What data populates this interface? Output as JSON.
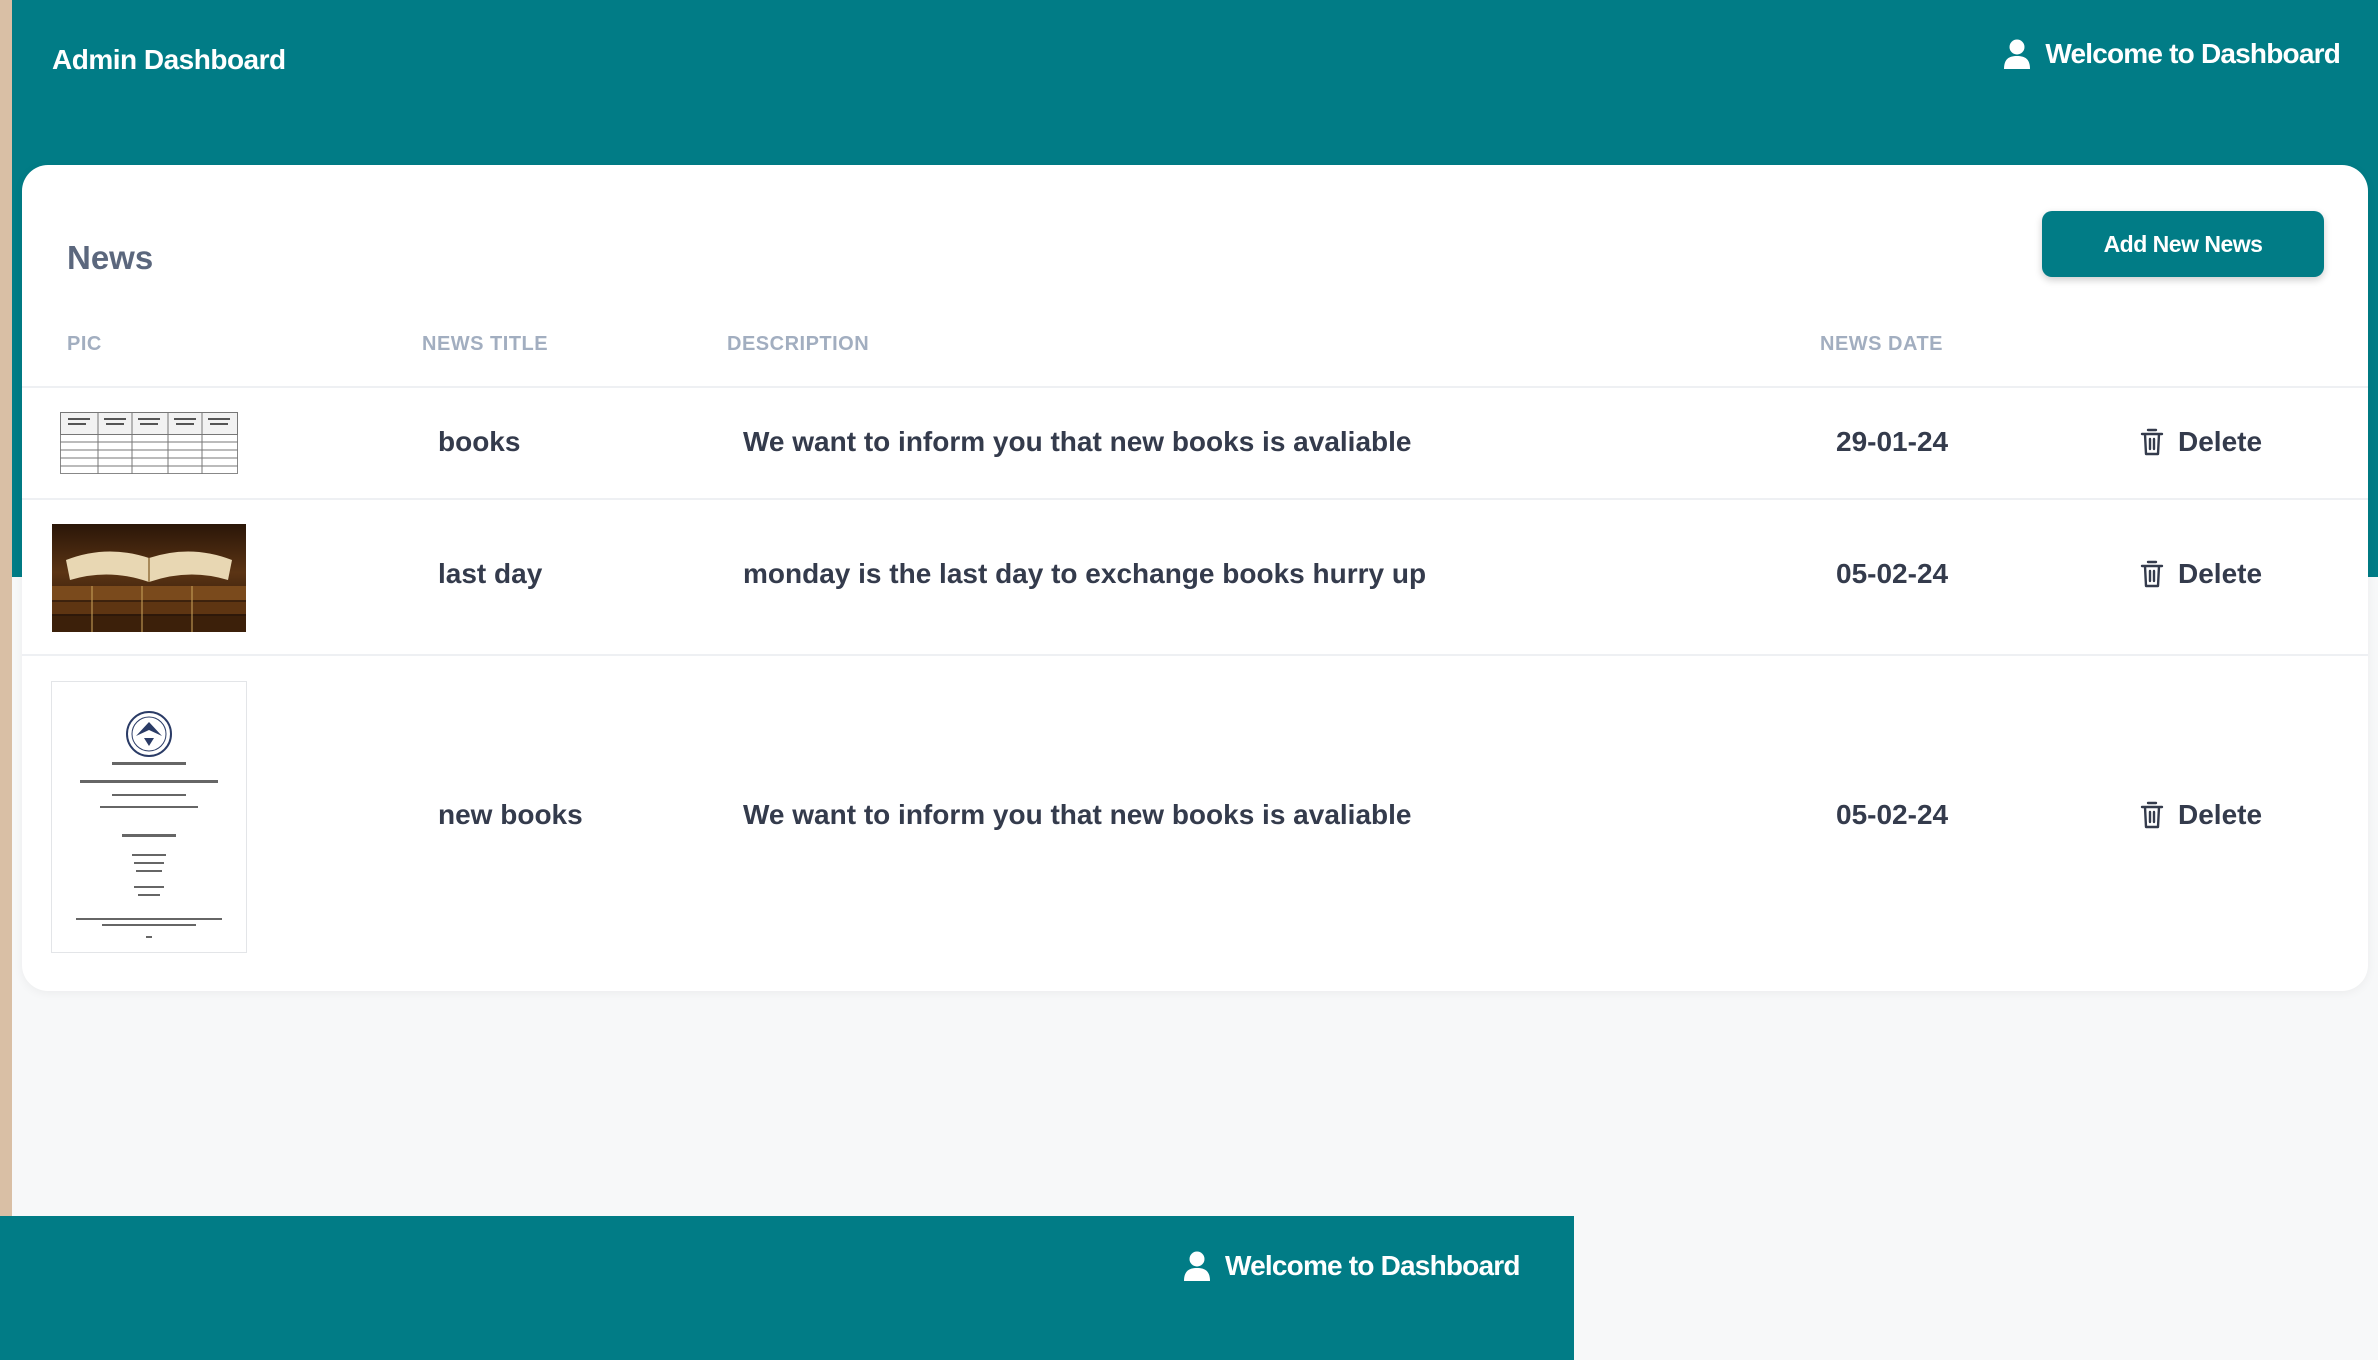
{
  "header": {
    "app_title": "Admin Dashboard",
    "welcome": "Welcome to Dashboard"
  },
  "footer": {
    "welcome": "Welcome to Dashboard"
  },
  "colors": {
    "primary": "#017c86",
    "page_bg": "#f7f8f9",
    "left_strip": "#d9bfa5",
    "text": "#343b4c",
    "muted": "#a2aec0"
  },
  "news": {
    "title": "News",
    "add_button": "Add New News",
    "columns": [
      "PIC",
      "NEWS TITLE",
      "DESCRIPTION",
      "NEWS DATE"
    ],
    "rows": [
      {
        "title": "books",
        "description": "We want to inform you that new books is avaliable",
        "date": "29-01-24",
        "action": "Delete",
        "pic": "table-document-thumbnail"
      },
      {
        "title": "last day",
        "description": "monday is the last day to exchange books hurry up",
        "date": "05-02-24",
        "action": "Delete",
        "pic": "open-book-photo"
      },
      {
        "title": "new books",
        "description": "We want to inform you that new books is avaliable",
        "date": "05-02-24",
        "action": "Delete",
        "pic": "certificate-document-thumbnail"
      }
    ]
  },
  "icons": {
    "user": "user-icon",
    "trash": "trash-icon"
  }
}
